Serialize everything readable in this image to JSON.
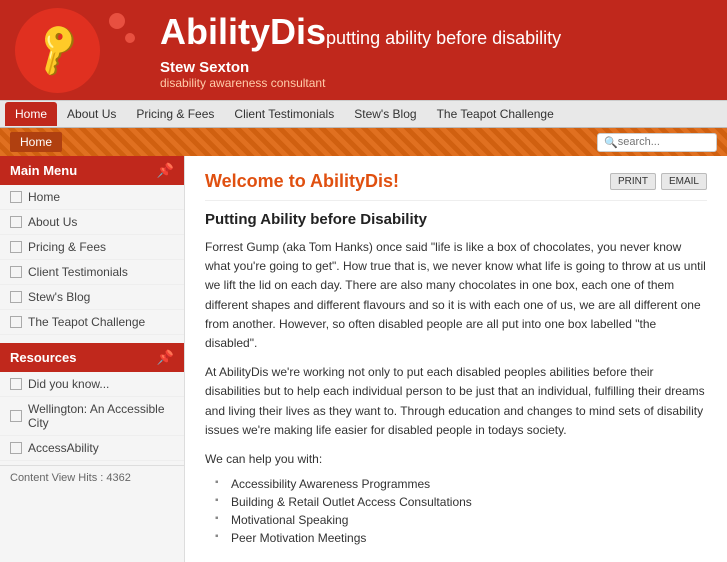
{
  "header": {
    "site_name": "AbilityDis",
    "tagline": "putting ability before disability",
    "person_name": "Stew Sexton",
    "person_title": "disability awareness consultant"
  },
  "navbar": {
    "items": [
      {
        "label": "Home",
        "active": true
      },
      {
        "label": "About Us",
        "active": false
      },
      {
        "label": "Pricing & Fees",
        "active": false
      },
      {
        "label": "Client Testimonials",
        "active": false
      },
      {
        "label": "Stew's Blog",
        "active": false
      },
      {
        "label": "The Teapot Challenge",
        "active": false
      }
    ]
  },
  "breadcrumb": {
    "label": "Home",
    "search_placeholder": "search..."
  },
  "sidebar": {
    "main_menu_header": "Main Menu",
    "main_menu_items": [
      {
        "label": "Home"
      },
      {
        "label": "About Us"
      },
      {
        "label": "Pricing & Fees"
      },
      {
        "label": "Client Testimonials"
      },
      {
        "label": "Stew's Blog"
      },
      {
        "label": "The Teapot Challenge"
      }
    ],
    "resources_header": "Resources",
    "resources_items": [
      {
        "label": "Did you know..."
      },
      {
        "label": "Wellington: An Accessible City"
      },
      {
        "label": "AccessAbility"
      }
    ],
    "counter_label": "Content View Hits : 4362"
  },
  "content": {
    "welcome_title": "Welcome to AbilityDis!",
    "print_label": "PRINT",
    "email_label": "EMAIL",
    "subtitle": "Putting Ability before Disability",
    "paragraph1": "Forrest Gump (aka Tom Hanks) once said \"life is like a box of chocolates, you never know what you're going to get\".  How true that is, we never know what life is going to throw at us until we lift the lid on each day.  There are also many chocolates in one box, each one of them different shapes and different flavours and so it is with each one of us, we are all different one from another.  However, so often disabled people are all put into one box labelled \"the disabled\".",
    "paragraph2": "At AbilityDis we're working not only to put each disabled peoples abilities before their disabilities but to help each individual person to be just that an individual, fulfilling their dreams and living their lives as they want to.  Through education and changes to mind sets of disability issues we're making life easier for disabled people in todays society.",
    "help_intro": "We can help you with:",
    "help_items": [
      "Accessibility Awareness Programmes",
      "Building & Retail Outlet Access Consultations",
      "Motivational Speaking",
      "Peer Motivation Meetings"
    ]
  }
}
